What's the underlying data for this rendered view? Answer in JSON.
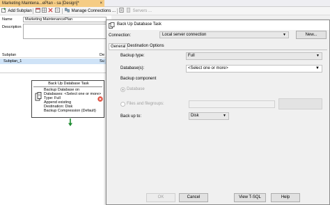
{
  "tab": {
    "title": "Marketing Maintena...ePlan - sa [Design]*",
    "close_glyph": "×"
  },
  "toolbar": {
    "add_subplan": "Add Subplan",
    "manage_connections": "Manage Connections ...",
    "servers": "Servers ..."
  },
  "properties": {
    "name_label": "Name",
    "name_value": "Marketing MaintenancePlan",
    "description_label": "Description",
    "subplan_header": "Subplan",
    "subplan_header_right": "De",
    "subplan_row": "Subplan_1",
    "subplan_row_right": "Su"
  },
  "task": {
    "title": "Back Up Database Task",
    "lines": [
      "Backup Database on",
      "Databases: <Select one or more>",
      "Type: Full",
      "Append existing",
      "Destination: Disk",
      "Backup Compression (Default)"
    ]
  },
  "dialog": {
    "title": "Back Up Database Task",
    "connection_label": "Connection:",
    "connection_value": "Local server connection",
    "new_button": "New...",
    "tabs": [
      "General",
      "Destination",
      "Options"
    ],
    "active_tab": "General",
    "backup_type_label": "Backup type:",
    "backup_type_value": "Full",
    "databases_label": "Database(s):",
    "databases_value": "<Select one or more>",
    "backup_component_label": "Backup component",
    "component_database": "Database",
    "component_files": "Files and filegroups:",
    "backup_to_label": "Back up to:",
    "backup_to_value": "Disk",
    "buttons": {
      "ok": "OK",
      "cancel": "Cancel",
      "view_tsql": "View T-SQL",
      "help": "Help"
    }
  },
  "colors": {
    "tab_accent": "#f5cc84",
    "selection": "#cfe3f7",
    "error_icon": "#e04a3a",
    "flow_arrow": "#1b8a2e"
  }
}
